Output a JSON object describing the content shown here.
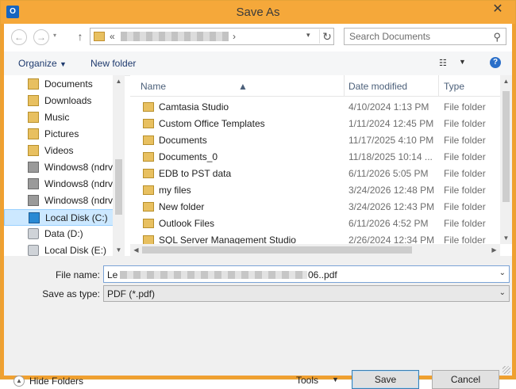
{
  "window": {
    "title": "Save As",
    "app_icon_letter": "O"
  },
  "address": {
    "chevron": "«",
    "separator": "›"
  },
  "search": {
    "placeholder": "Search Documents"
  },
  "toolbar": {
    "organize_label": "Organize",
    "new_folder_label": "New folder"
  },
  "sidebar": {
    "items": [
      {
        "label": "Documents",
        "icon": "folder-icon"
      },
      {
        "label": "Downloads",
        "icon": "downloads-folder-icon"
      },
      {
        "label": "Music",
        "icon": "music-folder-icon"
      },
      {
        "label": "Pictures",
        "icon": "pictures-folder-icon"
      },
      {
        "label": "Videos",
        "icon": "videos-folder-icon"
      },
      {
        "label": "Windows8 (ndrv",
        "icon": "network-drive-icon"
      },
      {
        "label": "Windows8 (ndrv",
        "icon": "network-drive-icon"
      },
      {
        "label": "Windows8 (ndrv",
        "icon": "network-drive-icon"
      },
      {
        "label": "Local Disk (C:)",
        "icon": "windows-drive-icon",
        "selected": true
      },
      {
        "label": "Data (D:)",
        "icon": "disk-icon"
      },
      {
        "label": "Local Disk (E:)",
        "icon": "locked-disk-icon"
      }
    ]
  },
  "columns": {
    "name": "Name",
    "date_modified": "Date modified",
    "type": "Type"
  },
  "files": [
    {
      "name": "Camtasia Studio",
      "date": "4/10/2024 1:13 PM",
      "type": "File folder"
    },
    {
      "name": "Custom Office Templates",
      "date": "1/11/2024 12:45 PM",
      "type": "File folder"
    },
    {
      "name": "Documents",
      "date": "11/17/2025 4:10 PM",
      "type": "File folder"
    },
    {
      "name": "Documents_0",
      "date": "11/18/2025 10:14 ...",
      "type": "File folder"
    },
    {
      "name": "EDB to PST data",
      "date": "6/11/2026 5:05 PM",
      "type": "File folder"
    },
    {
      "name": "my files",
      "date": "3/24/2026 12:48 PM",
      "type": "File folder"
    },
    {
      "name": "New folder",
      "date": "3/24/2026 12:43 PM",
      "type": "File folder"
    },
    {
      "name": "Outlook Files",
      "date": "6/11/2026 4:52 PM",
      "type": "File folder"
    },
    {
      "name": "SQL Server Management Studio",
      "date": "2/26/2024 12:34 PM",
      "type": "File folder"
    }
  ],
  "form": {
    "file_name_label": "File name:",
    "file_name_prefix": "Le",
    "file_name_suffix": "06..pdf",
    "save_as_type_label": "Save as type:",
    "save_as_type_value": "PDF (*.pdf)"
  },
  "footer": {
    "hide_folders_label": "Hide Folders",
    "tools_label": "Tools",
    "save_label": "Save",
    "cancel_label": "Cancel"
  }
}
